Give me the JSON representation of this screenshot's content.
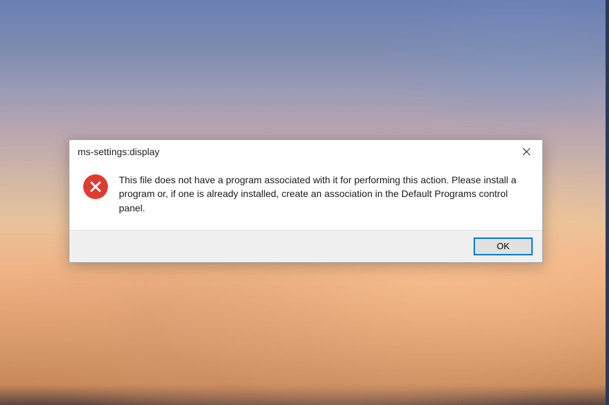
{
  "dialog": {
    "title": "ms-settings:display",
    "message": "This file does not have a program associated with it for performing this action. Please install a program or, if one is already installed, create an association in the Default Programs control panel.",
    "ok_label": "OK",
    "icon": "error-x-icon",
    "accent_color": "#0078d7",
    "error_color": "#e03b2f"
  }
}
